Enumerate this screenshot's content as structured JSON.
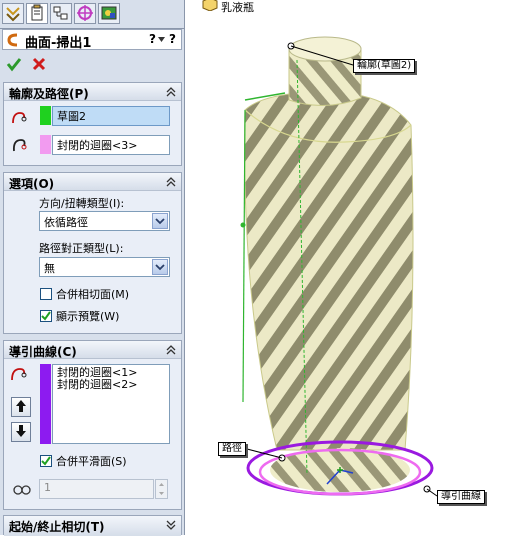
{
  "tabs": [
    "feature-manager-icon",
    "property-manager-icon",
    "config-manager-icon",
    "dimxpert-icon",
    "display-manager-icon"
  ],
  "panel": {
    "title": "曲面-掃出1",
    "help_icon": "?",
    "help_extra": "?",
    "ok_icon": "check-icon",
    "cancel_icon": "x-icon"
  },
  "profile_path": {
    "header": "輪廓及路徑(P)",
    "profile_value": "草圖2",
    "path_value": "封閉的迴圈<3>"
  },
  "options": {
    "header": "選項(O)",
    "orientation_label": "方向/扭轉類型(I):",
    "orientation_value": "依循路徑",
    "path_align_label": "路徑對正類型(L):",
    "path_align_value": "無",
    "merge_tangent_label": "合併相切面(M)",
    "merge_tangent_checked": false,
    "show_preview_label": "顯示預覽(W)",
    "show_preview_checked": true
  },
  "guide_curves": {
    "header": "導引曲線(C)",
    "items": [
      "封閉的迴圈<1>",
      "封閉的迴圈<2>"
    ],
    "merge_smooth_label": "合併平滑面(S)",
    "merge_smooth_checked": true,
    "spin_value": "1"
  },
  "start_end": {
    "header": "起始/終止相切(T)"
  },
  "viewport": {
    "tree_item": "乳液瓶",
    "callout_profile": "輪廓(草圖2)",
    "callout_path": "路徑",
    "callout_guide": "導引曲線"
  },
  "colors": {
    "profile_swatch": "#1fd11f",
    "path_swatch": "#f29bf0",
    "guide_swatch": "#8d1bf0",
    "path_ring": "#9a19e0",
    "guide_ring": "#ee6bf0"
  }
}
